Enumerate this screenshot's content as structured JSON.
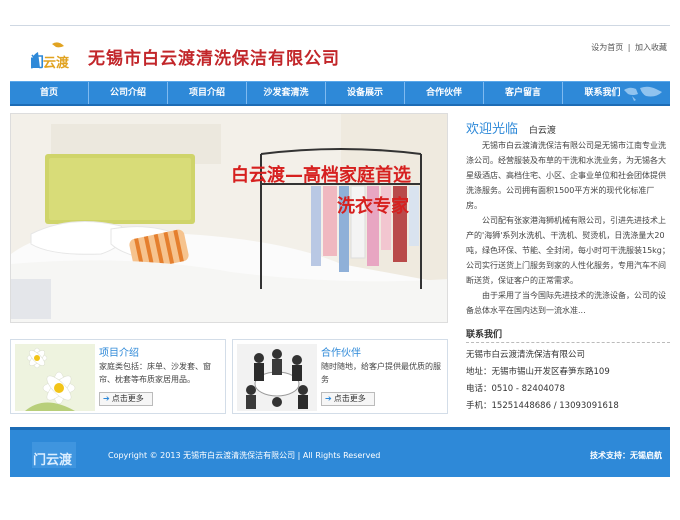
{
  "header": {
    "company_name": "无锡市白云渡清洗保洁有限公司",
    "logo_text": "白云渡",
    "links": [
      "设为首页",
      "加入收藏"
    ],
    "separator": "|"
  },
  "nav": {
    "items": [
      "首页",
      "公司介绍",
      "项目介绍",
      "沙发套清洗",
      "设备展示",
      "合作伙伴",
      "客户留言",
      "联系我们"
    ]
  },
  "banner": {
    "title": "白云渡—高档家庭首选",
    "subtitle": "洗衣专家"
  },
  "welcome": {
    "title": "欢迎光临",
    "subtitle": "白云渡",
    "paragraphs": [
      "无锡市白云渡清洗保洁有限公司是无锡市江南专业洗涤公司。经营服装及布草的干洗和水洗业务，为无锡各大星级酒店、高档住宅、小区、企事业单位和社会团体提供洗涤服务。公司拥有面积1500平方米的现代化标准厂房。",
      "公司配有张家港海狮机械有限公司，引进先进技术上产的'海狮'系列水洗机、干洗机、熨烫机，日洗涤量大20吨，绿色环保、节能、全封闭，每小时可干洗服装15kg；公司实行送货上门服务到家的人性化服务，专用汽车不间断送货，保证客户的正常需求。",
      "由于采用了当今国际先进技术的洗涤设备，公司的设备总体水平在国内达到一流水准..."
    ]
  },
  "contact": {
    "title": "联系我们",
    "company": "无锡市白云渡清洗保洁有限公司",
    "address": "地址：无锡市锡山开发区春笋东路109",
    "phone": "电话：0510 - 82404078",
    "mobile": "手机：15251448686 / 13093091618"
  },
  "boxes": [
    {
      "title": "项目介绍",
      "text": "家庭类包括：床单、沙发套、窗帘、枕套等布质家居用品。",
      "more": "点击更多"
    },
    {
      "title": "合作伙伴",
      "text": "随时随地，给客户提供最优质的服务",
      "more": "点击更多"
    }
  ],
  "footer": {
    "copyright": "Copyright © 2013 无锡市白云渡清洗保洁有限公司 | All Rights Reserved",
    "tech": "技术支持：无锡启航"
  },
  "colors": {
    "brand_blue": "#2e89d8",
    "brand_red": "#c2262a"
  }
}
